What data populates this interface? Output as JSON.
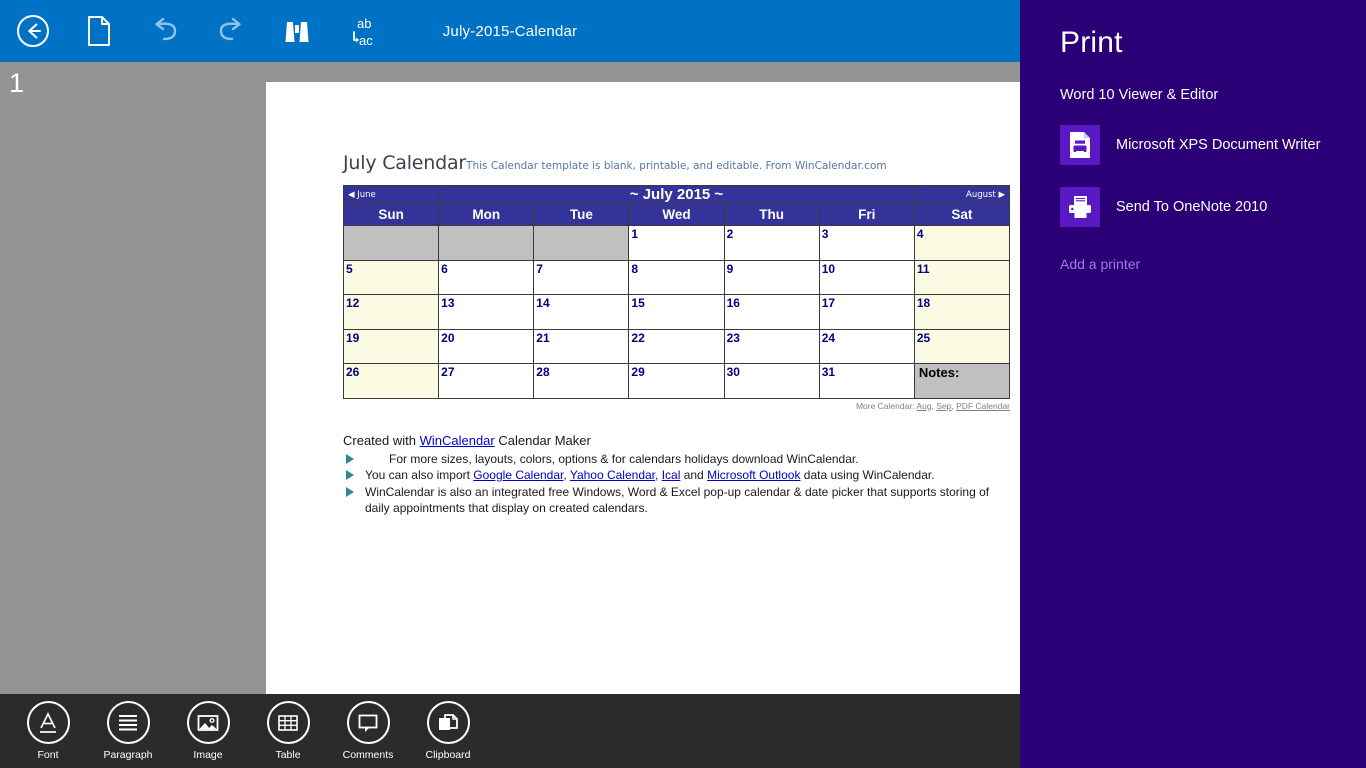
{
  "toolbar": {
    "buttons": [
      {
        "name": "back-button",
        "icon": "back-arrow-circle-icon"
      },
      {
        "name": "new-document-button",
        "icon": "document-icon"
      },
      {
        "name": "undo-button",
        "icon": "undo-icon"
      },
      {
        "name": "redo-button",
        "icon": "redo-icon"
      },
      {
        "name": "find-button",
        "icon": "binoculars-icon"
      },
      {
        "name": "replace-button",
        "icon": "find-replace-icon",
        "top_text": "ab",
        "bottom_text": "ac"
      }
    ],
    "document_title": "July-2015-Calendar"
  },
  "workspace": {
    "page_number": "1"
  },
  "document": {
    "title": "July Calendar",
    "subtitle": "This Calendar template is blank, printable, and editable.  From WinCalendar.com",
    "calendar": {
      "prev_month": "◀ June",
      "month_title": "~ July 2015 ~",
      "next_month": "August ▶",
      "weekdays": [
        "Sun",
        "Mon",
        "Tue",
        "Wed",
        "Thu",
        "Fri",
        "Sat"
      ],
      "weeks": [
        [
          "",
          "",
          "",
          "1",
          "2",
          "3",
          "4"
        ],
        [
          "5",
          "6",
          "7",
          "8",
          "9",
          "10",
          "11"
        ],
        [
          "12",
          "13",
          "14",
          "15",
          "16",
          "17",
          "18"
        ],
        [
          "19",
          "20",
          "21",
          "22",
          "23",
          "24",
          "25"
        ],
        [
          "26",
          "27",
          "28",
          "29",
          "30",
          "31",
          "Notes:"
        ]
      ],
      "notes_label": "Notes:",
      "more_calendar": {
        "prefix": "More Calendar: ",
        "links": [
          "Aug",
          "Sep",
          "PDF Calendar"
        ]
      }
    },
    "created_line": {
      "prefix": "Created with ",
      "link": "WinCalendar",
      "suffix": " Calendar Maker"
    },
    "features": [
      {
        "indent": true,
        "parts": [
          {
            "text": "For more sizes, layouts, colors, options & for calendars holidays download WinCalendar.",
            "link": false
          }
        ]
      },
      {
        "indent": false,
        "parts": [
          {
            "text": "You can also import ",
            "link": false
          },
          {
            "text": "Google Calendar",
            "link": true
          },
          {
            "text": ", ",
            "link": false
          },
          {
            "text": "Yahoo Calendar",
            "link": true
          },
          {
            "text": ", ",
            "link": false
          },
          {
            "text": "Ical",
            "link": true
          },
          {
            "text": " and ",
            "link": false
          },
          {
            "text": "Microsoft Outlook",
            "link": true
          },
          {
            "text": " data using WinCalendar.",
            "link": false
          }
        ]
      },
      {
        "indent": false,
        "parts": [
          {
            "text": "WinCalendar is also an integrated free Windows, Word & Excel pop-up calendar & date picker that supports storing of daily appointments that display on created calendars.",
            "link": false
          }
        ]
      }
    ]
  },
  "bottom_toolbar": [
    {
      "name": "font",
      "label": "Font",
      "icon": "font-a-underline-icon"
    },
    {
      "name": "paragraph",
      "label": "Paragraph",
      "icon": "paragraph-lines-icon"
    },
    {
      "name": "image",
      "label": "Image",
      "icon": "image-picture-icon"
    },
    {
      "name": "table",
      "label": "Table",
      "icon": "table-grid-icon"
    },
    {
      "name": "comments",
      "label": "Comments",
      "icon": "comment-bubble-icon"
    },
    {
      "name": "clipboard",
      "label": "Clipboard",
      "icon": "clipboard-copy-icon"
    }
  ],
  "print_panel": {
    "heading": "Print",
    "app_name": "Word 10 Viewer & Editor",
    "printers": [
      {
        "name": "Microsoft XPS Document Writer",
        "icon": "xps-document-printer-icon"
      },
      {
        "name": "Send To OneNote 2010",
        "icon": "printer-icon"
      }
    ],
    "add_printer_label": "Add a printer"
  },
  "colors": {
    "topbar_blue": "#0072c6",
    "workspace_gray": "#939393",
    "bottombar_dark": "#2b2b2b",
    "print_panel_indigo": "#290075",
    "printer_tile": "#5a17c4",
    "calendar_header_blue": "#333399",
    "calendar_weekend": "#fbfbe4",
    "calendar_blank": "#c0c0c0",
    "day_number_navy": "#000080",
    "link_blue": "#0000cc",
    "bullet_teal": "#2e8b87",
    "add_printer_link": "#9a7ee0"
  }
}
